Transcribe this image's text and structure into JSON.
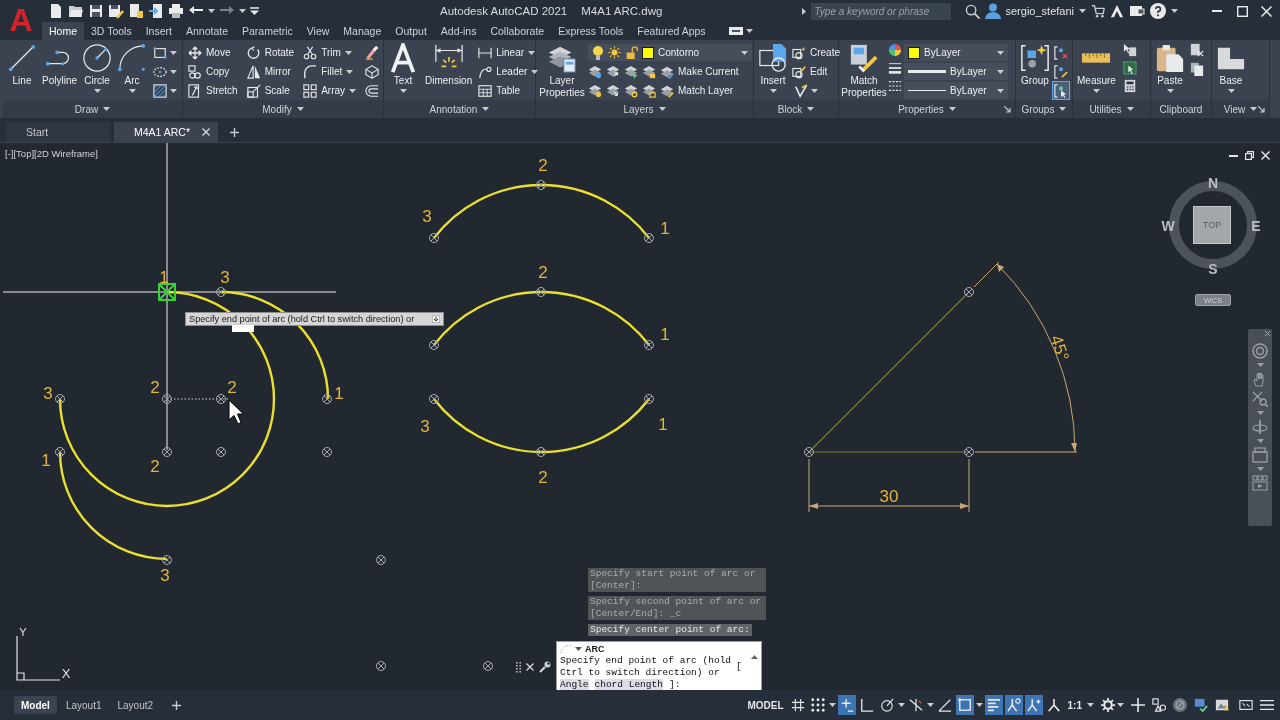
{
  "title_bar": {
    "logo": "A",
    "title": "Autodesk AutoCAD 2021",
    "file": "M4A1 ARC.dwg",
    "search": {
      "placeholder": "Type a keyword or phrase"
    },
    "user": "sergio_stefani"
  },
  "ribbon": {
    "tabs": [
      {
        "label": "Home",
        "selected": true
      },
      {
        "label": "3D Tools",
        "selected": false
      },
      {
        "label": "Insert",
        "selected": false
      },
      {
        "label": "Annotate",
        "selected": false
      },
      {
        "label": "Parametric",
        "selected": false
      },
      {
        "label": "View",
        "selected": false
      },
      {
        "label": "Manage",
        "selected": false
      },
      {
        "label": "Output",
        "selected": false
      },
      {
        "label": "Add-ins",
        "selected": false
      },
      {
        "label": "Collaborate",
        "selected": false
      },
      {
        "label": "Express Tools",
        "selected": false
      },
      {
        "label": "Featured Apps",
        "selected": false
      }
    ],
    "panels": [
      {
        "title": "Draw",
        "tools": [
          "Line",
          "Polyline",
          "Circle",
          "Arc"
        ]
      },
      {
        "title": "Modify",
        "tools": [
          "Move",
          "Rotate",
          "Trim",
          "Copy",
          "Mirror",
          "Fillet",
          "Stretch",
          "Scale",
          "Array"
        ]
      },
      {
        "title": "Annotation",
        "tools": [
          "Text",
          "Dimension",
          "Linear",
          "Leader",
          "Table"
        ]
      },
      {
        "title": "Layers",
        "tools": [
          "Layer Properties",
          "Make Current",
          "Match Layer"
        ],
        "layer": {
          "name": "Contorno",
          "color": "#ffff00",
          "on": true,
          "frozen": false,
          "locked": false
        }
      },
      {
        "title": "Block",
        "tools": [
          "Insert",
          "Create",
          "Edit"
        ]
      },
      {
        "title": "Properties",
        "tools": [
          "Match Properties"
        ],
        "dropdowns": [
          {
            "kind": "color",
            "value": "ByLayer",
            "color": "#ffff00"
          },
          {
            "kind": "lineweight",
            "value": "ByLayer"
          },
          {
            "kind": "linetype",
            "value": "ByLayer"
          }
        ]
      },
      {
        "title": "Groups",
        "tools": [
          "Group"
        ],
        "group_selection": {
          "on": true
        }
      },
      {
        "title": "Utilities",
        "tools": [
          "Measure"
        ]
      },
      {
        "title": "Clipboard",
        "tools": [
          "Paste"
        ]
      },
      {
        "title": "View",
        "tools": [
          "Base"
        ]
      }
    ]
  },
  "file_tabs": [
    {
      "label": "Start",
      "selected": false
    },
    {
      "label": "M4A1 ARC*",
      "selected": true
    }
  ],
  "viewport": {
    "controls": [
      "[-]",
      "[Top]",
      "[2D Wireframe]"
    ],
    "point_labels": [
      "2",
      "3",
      "1",
      "1",
      "3",
      "2",
      "1",
      "3",
      "2",
      "2",
      "1",
      "3",
      "1",
      "1",
      "2",
      "2",
      "3"
    ],
    "angle_dimension": "45°",
    "length_dimension": "30",
    "tooltip": "Specify end point of arc (hold Ctrl to switch direction) or",
    "viewcube": {
      "north": "N",
      "east": "E",
      "south": "S",
      "west": "W",
      "face": "TOP",
      "ucs": "WCS"
    },
    "ucs_axes": {
      "x": "X",
      "y": "Y"
    }
  },
  "command_line": {
    "history": [
      "Specify start point of arc or [Center]:",
      "Specify second point of arc or [Center/End]: _c",
      "Specify center point of arc:"
    ],
    "command": "ARC",
    "prompt": "Specify end point of arc (hold Ctrl to switch direction) or",
    "open": "[",
    "options": [
      "Angle",
      "chord Length"
    ],
    "close": "]:"
  },
  "status_bar": {
    "layouts": [
      {
        "label": "Model",
        "selected": true
      },
      {
        "label": "Layout1",
        "selected": false
      },
      {
        "label": "Layout2",
        "selected": false
      }
    ],
    "space": "MODEL",
    "toggles": [
      {
        "on": false
      },
      {
        "on": false
      },
      {
        "on": true
      },
      {
        "on": false
      },
      {
        "on": false
      },
      {
        "on": false
      },
      {
        "on": false
      },
      {
        "on": true
      },
      {
        "on": true
      },
      {
        "on": true
      },
      {
        "on": true
      }
    ],
    "scale": "1:1"
  }
}
